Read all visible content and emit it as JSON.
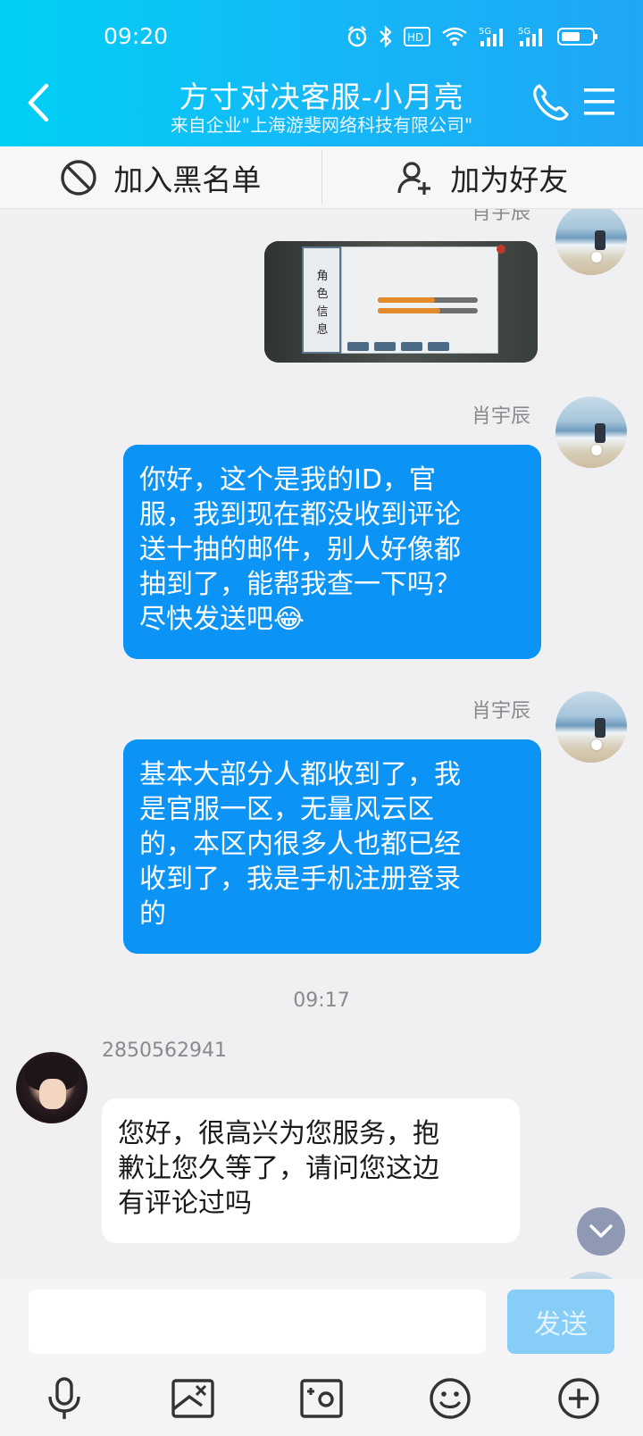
{
  "status_bar": {
    "time": "09:20",
    "icons": [
      "alarm-icon",
      "bluetooth-icon",
      "hd-icon",
      "wifi-icon",
      "5g-signal-icon",
      "5g-signal-icon",
      "battery-icon"
    ]
  },
  "header": {
    "title": "方寸对决客服-小月亮",
    "subtitle": "来自企业\"上海游斐网络科技有限公司\""
  },
  "action_bar": {
    "blacklist_label": "加入黑名单",
    "add_friend_label": "加为好友"
  },
  "messages": {
    "partial_name": "肖宇辰",
    "image_text": "角色信息",
    "msg1": {
      "sender": "肖宇辰",
      "text": "你好，这个是我的ID，官\n服，我到现在都没收到评论\n送十抽的邮件，别人好像都\n抽到了，能帮我查一下吗？\n尽快发送吧😂"
    },
    "msg2": {
      "sender": "肖宇辰",
      "text": "基本大部分人都收到了，我\n是官服一区，无量风云区\n的，本区内很多人也都已经\n收到了，我是手机注册登录\n的"
    },
    "timestamp": "09:17",
    "msg3": {
      "sender": "2850562941",
      "text": "您好，很高兴为您服务，抱\n歉让您久等了，请问您这边\n有评论过吗"
    }
  },
  "input": {
    "placeholder": "",
    "send_label": "发送"
  },
  "colors": {
    "header_start": "#00d0f5",
    "header_end": "#1fa6f5",
    "bubble_me": "#0b93f6",
    "bubble_them": "#ffffff",
    "send_disabled": "#86cdf8"
  }
}
